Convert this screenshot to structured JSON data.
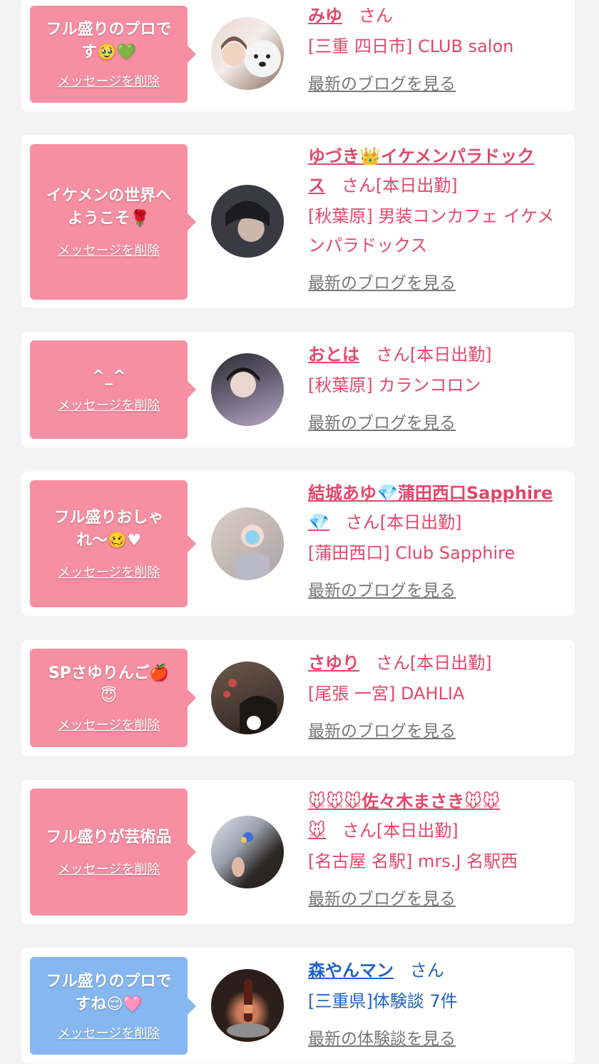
{
  "delete_label": "メッセージを削除",
  "cards": [
    {
      "message": "フル盛りのプロで\nす🥹💚",
      "name": "みゆ",
      "suffix": "さん",
      "shop": "[三重 四日市] CLUB salon",
      "link": "最新のブログを見る",
      "bubble_color": "#f58fa1",
      "avatar_colors": [
        "#e8d7d0",
        "#8a6a5c"
      ]
    },
    {
      "message": "イケメンの世界へ\nようこそ🌹",
      "name": "ゆづき👑イケメンパラドック\nス",
      "suffix": "さん[本日出勤]",
      "shop": "[秋葉原] 男装コンカフェ イケメンパラドックス",
      "link": "最新のブログを見る",
      "bubble_color": "#f58fa1",
      "avatar_colors": [
        "#3a3a42",
        "#cdb7ad"
      ]
    },
    {
      "message": "^_^",
      "name": "おとは",
      "suffix": "さん[本日出勤]",
      "shop": "[秋葉原] カランコロン",
      "link": "最新のブログを見る",
      "bubble_color": "#f58fa1",
      "avatar_colors": [
        "#2c2c34",
        "#b5a7c7"
      ]
    },
    {
      "message": "フル盛りおしゃ\nれ〜🥴♥",
      "name": "結城あゆ💎蒲田西口Sapphire\n💎",
      "suffix": "さん[本日出勤]",
      "shop": "[蒲田西口] Club Sapphire",
      "link": "最新のブログを見る",
      "bubble_color": "#f58fa1",
      "avatar_colors": [
        "#d9cfc7",
        "#a8a3ad"
      ]
    },
    {
      "message": "SPさゆりんご🍎\n😇",
      "name": "さゆり",
      "suffix": "さん[本日出勤]",
      "shop": "[尾張 一宮] DAHLIA",
      "link": "最新のブログを見る",
      "bubble_color": "#f58fa1",
      "avatar_colors": [
        "#6d5a4d",
        "#2a211d"
      ]
    },
    {
      "message": "フル盛りが芸術品",
      "name": "🐭🐭🐭佐々木まさき🐭🐭\n🐭",
      "suffix": "さん[本日出勤]",
      "shop": "[名古屋 名駅] mrs.J 名駅西",
      "link": "最新のブログを見る",
      "bubble_color": "#f58fa1",
      "avatar_colors": [
        "#dfe4ee",
        "#2b2523"
      ]
    },
    {
      "message": "フル盛りのプロで\nすね😌🩷",
      "name": "森やんマン",
      "suffix": "さん",
      "shop": "[三重県]体験談 7件",
      "link": "最新の体験談を見る",
      "bubble_color": "#86b7f0",
      "avatar_colors": [
        "#2c1e1a",
        "#c97b5a"
      ]
    }
  ]
}
